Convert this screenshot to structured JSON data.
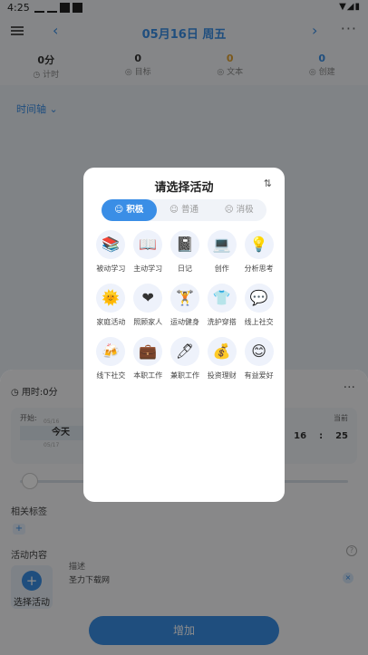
{
  "status_bar": {
    "time": "4:25",
    "right": "▼◢▮"
  },
  "header": {
    "prev": "‹",
    "date": "05月16日 周五",
    "next": "›",
    "more": "···"
  },
  "stats": [
    {
      "value": "0分",
      "label": "◷ 计时"
    },
    {
      "value": "0",
      "label": "◎ 目标"
    },
    {
      "value": "0",
      "label": "◎ 文本"
    },
    {
      "value": "0",
      "label": "◎ 创建"
    }
  ],
  "timeline_link": "时间轴 ⌄",
  "sheet": {
    "used_time": "◷ 用时:0分",
    "more": "···",
    "start_label": "开始:",
    "end_label": "当前",
    "start_prev": "05/16",
    "start_date": "今天",
    "start_next": "05/17",
    "end_hour": "16",
    "end_sep": ":",
    "end_min": "25",
    "tags_label": "相关标签",
    "tags_add": "+",
    "content_label": "活动内容",
    "help": "?",
    "pick_plus": "+",
    "pick_label": "选择活动",
    "desc_label": "描述",
    "desc_value": "圣力下载网",
    "desc_clear": "×",
    "add_button": "增加"
  },
  "dialog": {
    "title": "请选择活动",
    "sort_icon": "⇅",
    "tabs": [
      {
        "label": "☺ 积极",
        "active": true
      },
      {
        "label": "☺ 普通",
        "active": false
      },
      {
        "label": "☹ 消极",
        "active": false
      }
    ],
    "activities": [
      {
        "label": "被动学习",
        "icon": "📚",
        "icon_name": "books-icon"
      },
      {
        "label": "主动学习",
        "icon": "📖",
        "icon_name": "open-book-icon"
      },
      {
        "label": "日记",
        "icon": "📓",
        "icon_name": "notebook-icon"
      },
      {
        "label": "创作",
        "icon": "💻",
        "icon_name": "laptop-icon"
      },
      {
        "label": "分析思考",
        "icon": "💡",
        "icon_name": "light-bulb-icon"
      },
      {
        "label": "家庭活动",
        "icon": "🌞",
        "icon_name": "sun-icon"
      },
      {
        "label": "照顾家人",
        "icon": "❤",
        "icon_name": "heart-icon"
      },
      {
        "label": "运动健身",
        "icon": "🏋",
        "icon_name": "weightlifter-icon"
      },
      {
        "label": "洗护穿搭",
        "icon": "👕",
        "icon_name": "t-shirt-icon"
      },
      {
        "label": "线上社交",
        "icon": "💬",
        "icon_name": "chat-icon"
      },
      {
        "label": "线下社交",
        "icon": "🍻",
        "icon_name": "cheers-icon"
      },
      {
        "label": "本职工作",
        "icon": "💼",
        "icon_name": "briefcase-icon"
      },
      {
        "label": "兼职工作",
        "icon": "🖊",
        "icon_name": "pen-icon"
      },
      {
        "label": "投资理财",
        "icon": "💰",
        "icon_name": "money-bag-icon"
      },
      {
        "label": "有益爱好",
        "icon": "😊",
        "icon_name": "smile-icon"
      }
    ]
  }
}
